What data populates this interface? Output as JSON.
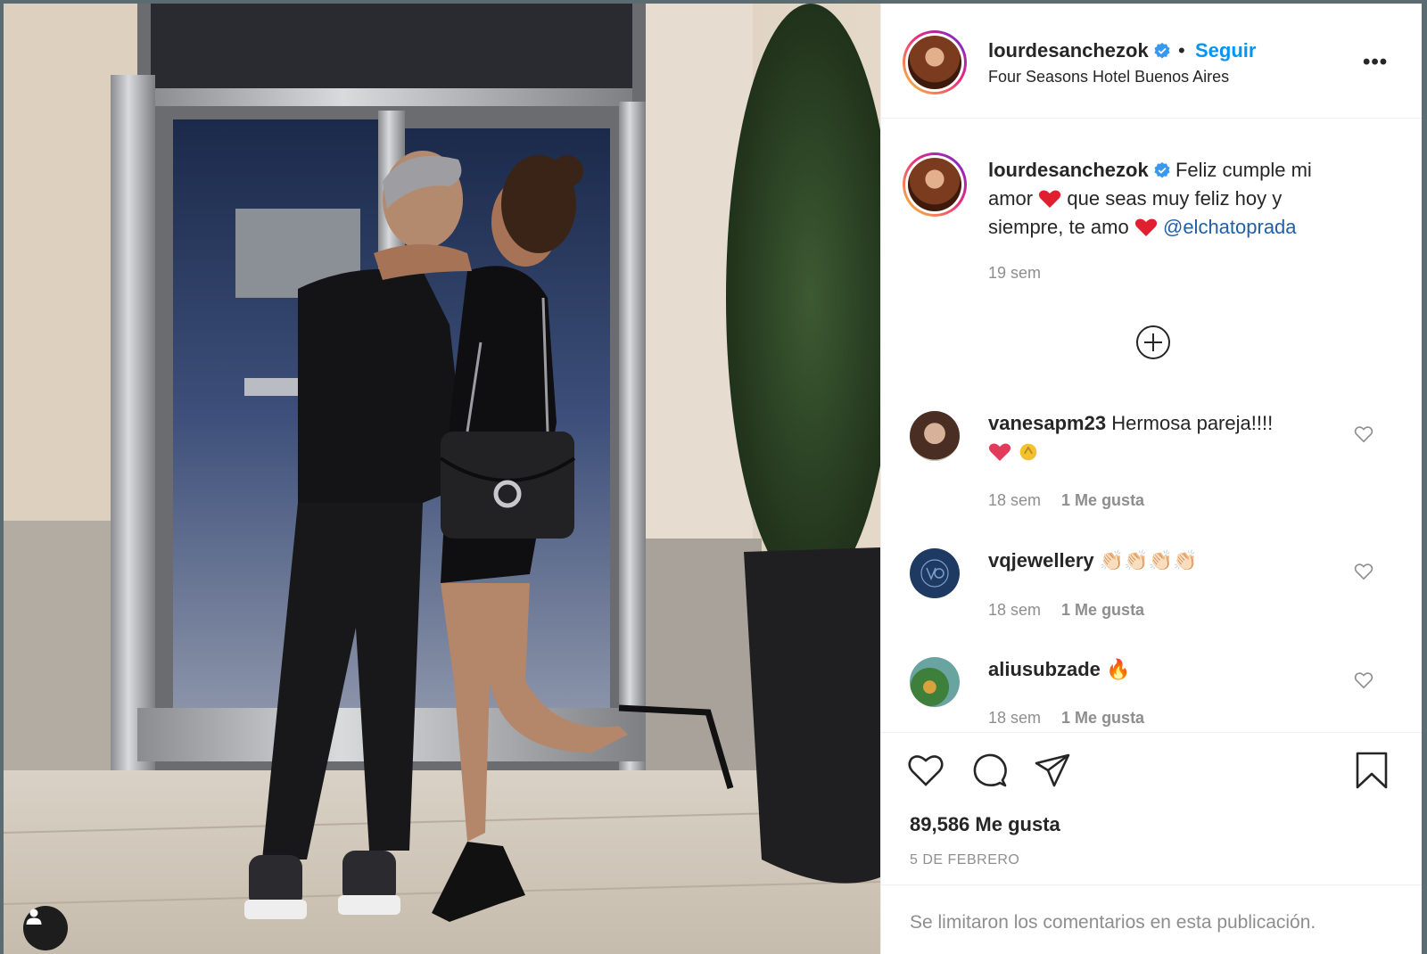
{
  "post": {
    "username": "lourdesanchezok",
    "follow_label": "Seguir",
    "separator": "•",
    "location": "Four Seasons Hotel Buenos Aires",
    "more_label": "•••"
  },
  "caption": {
    "username": "lourdesanchezok",
    "line1": "Feliz cumple mi",
    "line2a": "amor",
    "line2b": "que seas muy feliz hoy y",
    "line3a": "siempre, te amo",
    "mention": "@elchatoprada",
    "time": "19 sem"
  },
  "comments": [
    {
      "username": "vanesapm23",
      "text": "Hermosa pareja!!!!",
      "time": "18 sem",
      "likes": "1 Me gusta"
    },
    {
      "username": "vqjewellery",
      "text": "👏🏻👏🏻👏🏻👏🏻",
      "time": "18 sem",
      "likes": "1 Me gusta"
    },
    {
      "username": "aliusubzade",
      "text": "🔥",
      "time": "18 sem",
      "likes": "1 Me gusta"
    }
  ],
  "footer": {
    "likes_count": "89,586 Me gusta",
    "date": "5 DE FEBRERO",
    "comments_limited": "Se limitaron los comentarios en esta publicación."
  },
  "colors": {
    "link_blue": "#0095f6",
    "verified_blue": "#3897f0",
    "heart_red": "#ed4956",
    "muted_gray": "#8e8e8e"
  },
  "icons": {
    "header": [
      "verified-badge-icon",
      "more-options-icon"
    ],
    "actions": [
      "like-heart-icon",
      "comment-bubble-icon",
      "share-paper-plane-icon",
      "bookmark-icon"
    ],
    "photo": [
      "user-tag-icon"
    ],
    "comments": [
      "load-more-plus-icon",
      "comment-like-heart-icon"
    ]
  }
}
